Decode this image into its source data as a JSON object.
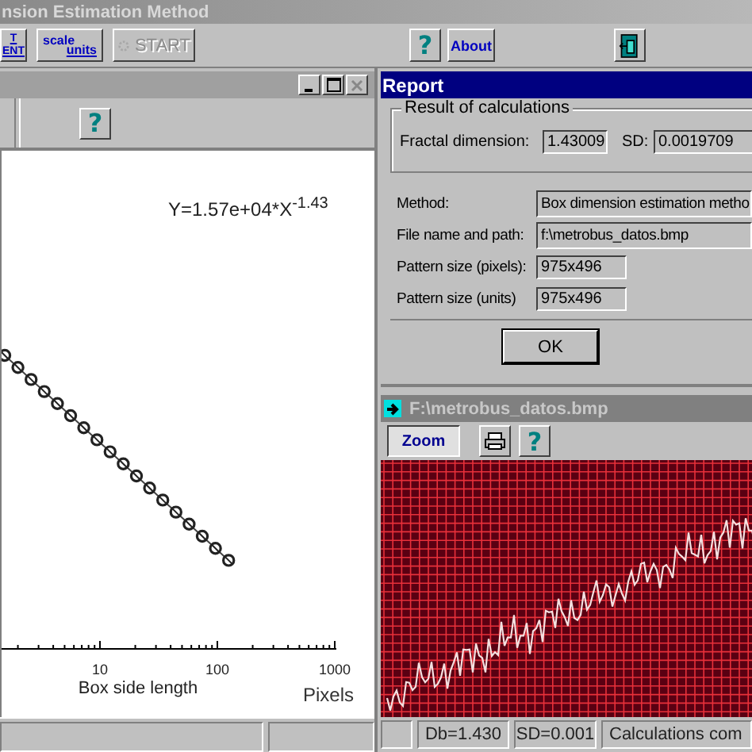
{
  "window": {
    "title": "nsion Estimation Method"
  },
  "toolbar": [
    {
      "kind": "stack",
      "lines": [
        "T",
        "ENT"
      ],
      "disabled": false
    },
    {
      "kind": "scale",
      "lines": [
        "scale",
        "units"
      ],
      "disabled": false
    },
    {
      "kind": "start",
      "label": "START",
      "disabled": true
    },
    {
      "kind": "help",
      "label": "?",
      "disabled": false
    },
    {
      "kind": "text",
      "label": "About",
      "disabled": false
    },
    {
      "kind": "exit",
      "disabled": false
    }
  ],
  "plot_window": {
    "help": "?",
    "equation": "Y=1.57e+04*X$^{-1.43}$",
    "xticks": [
      "10",
      "100",
      "1000"
    ],
    "xlabel": "Box side length",
    "unit": "Pixels"
  },
  "report": {
    "title": "Report",
    "group": "Result of calculations",
    "fractal_label": "Fractal dimension:",
    "fractal_value": "1.43009",
    "sd_label": "SD:",
    "sd_value": "0.0019709",
    "fields": [
      {
        "label": "Method:",
        "value": "Box dimension estimation metho",
        "wide": true
      },
      {
        "label": "File name and path:",
        "value": "f:\\metrobus_datos.bmp",
        "wide": true
      },
      {
        "label": "Pattern size (pixels):",
        "value": "975x496",
        "wide": false
      },
      {
        "label": "Pattern size (units)",
        "value": "975x496",
        "wide": false
      }
    ],
    "ok": "OK"
  },
  "image_window": {
    "title": "F:\\metrobus_datos.bmp",
    "zoom": "Zoom",
    "help": "?",
    "status": [
      "Db=1.430",
      "SD=0.001",
      "Calculations com"
    ]
  }
}
